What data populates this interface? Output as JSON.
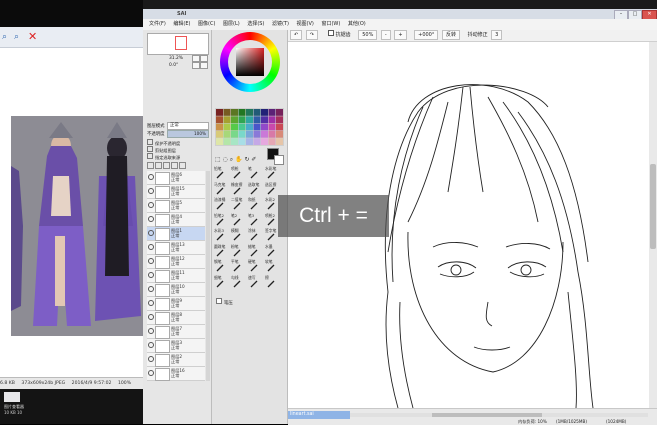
{
  "viewer": {
    "status": {
      "zoom": "6.8 KB",
      "dimensions": "373x609x24b JPEG",
      "datetime": "2016/4/9 9:57:02",
      "zoom_pct": "100%"
    },
    "taskbar_label": "图片查看器",
    "taskbar_sub": "10 KB  10"
  },
  "sai": {
    "title": "SAI",
    "menu": [
      "文件(F)",
      "编辑(E)",
      "图像(C)",
      "图层(L)",
      "选择(S)",
      "滤镜(T)",
      "视图(V)",
      "窗口(W)",
      "其他(O)"
    ],
    "left_pane": {
      "nav_zoom": "31.2%",
      "nav_angle": "0.0°",
      "blend_mode_label": "图层模式",
      "blend_mode_value": "正常",
      "opacity_label": "不透明度",
      "opacity_value": "100%",
      "checks": [
        "保护不透明度",
        "剪贴组图层",
        "指定选取来源"
      ],
      "layers": [
        {
          "name": "图层6",
          "mode": "正常",
          "opacity": "100%"
        },
        {
          "name": "图层15",
          "mode": "正常",
          "opacity": "100%"
        },
        {
          "name": "图层5",
          "mode": "正常",
          "opacity": "100%"
        },
        {
          "name": "图层4",
          "mode": "正常",
          "opacity": "100%"
        },
        {
          "name": "图层1",
          "mode": "正常",
          "opacity": "100%"
        },
        {
          "name": "图层13",
          "mode": "正常",
          "opacity": "100%"
        },
        {
          "name": "图层12",
          "mode": "正常",
          "opacity": "100%"
        },
        {
          "name": "图层11",
          "mode": "正常",
          "opacity": "100%"
        },
        {
          "name": "图层10",
          "mode": "正常",
          "opacity": "100%"
        },
        {
          "name": "图层9",
          "mode": "正常",
          "opacity": "100%"
        },
        {
          "name": "图层8",
          "mode": "正常",
          "opacity": "100%"
        },
        {
          "name": "图层7",
          "mode": "正常",
          "opacity": "100%"
        },
        {
          "name": "图层3",
          "mode": "正常",
          "opacity": "100%"
        },
        {
          "name": "图层2",
          "mode": "正常",
          "opacity": "100%"
        },
        {
          "name": "图层16",
          "mode": "正常",
          "opacity": "100%"
        }
      ]
    },
    "mid_pane": {
      "brushes": [
        "铅笔",
        "喷枪",
        "笔",
        "水彩笔",
        "马克笔",
        "橡皮擦",
        "选取笔",
        "选区擦",
        "油漆桶",
        "二值笔",
        "和纸",
        "水彩2",
        "铅笔2",
        "笔2",
        "笔3",
        "喷枪2",
        "水彩3",
        "模糊",
        "涂抹",
        "签字笔",
        "圆珠笔",
        "粉笔",
        "蜡笔",
        "水墨",
        "钢笔",
        "平笔",
        "硬笔",
        "软笔",
        "细笔",
        "勾线",
        "速写",
        "擦"
      ],
      "pressure_label": "笔压"
    },
    "canvas_toolbar": {
      "checkbox_label": "抗锯齿",
      "zoom_value": "50%",
      "angle_value": "+000°",
      "flip_label": "反转",
      "stabilizer_label": "抖动修正",
      "stabilizer_value": "3"
    },
    "canvas_status": {
      "file_tab": "lineart.sai",
      "memory": "内存负荷: 10%",
      "disk": "(1MB/1025MB)",
      "extra": "(1024MB)"
    }
  },
  "overlay": {
    "key_hint": "Ctrl + ="
  },
  "colors": {
    "selected_layer": "#c7d7f2",
    "overlay_bg": "#505050"
  }
}
